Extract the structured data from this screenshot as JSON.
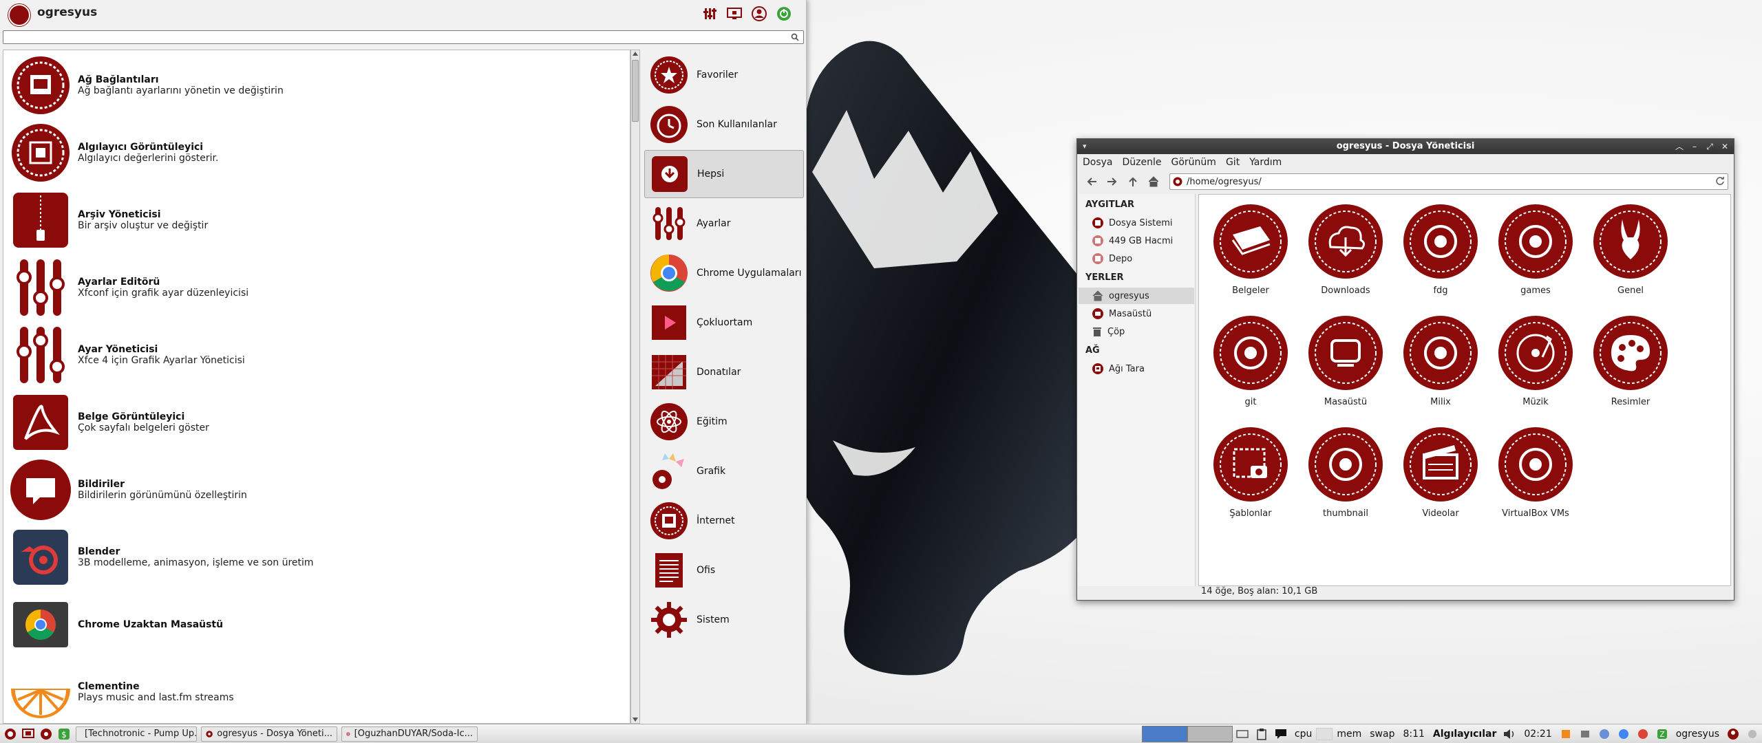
{
  "colors": {
    "accent": "#8b0a0a",
    "workspace_active": "#4a7cc9",
    "selection": "#dcdcdc"
  },
  "menu": {
    "username": "ogresyus",
    "actions": [
      "settings-icon",
      "lock-screen-icon",
      "switch-user-icon",
      "logout-icon"
    ],
    "search": {
      "placeholder": "",
      "value": ""
    },
    "apps": [
      {
        "name": "Ağ Bağlantıları",
        "desc": "Ağ bağlantı ayarlarını yönetin ve değiştirin",
        "icon": "network-icon"
      },
      {
        "name": "Algılayıcı Görüntüleyici",
        "desc": "Algılayıcı değerlerini gösterir.",
        "icon": "sensor-icon"
      },
      {
        "name": "Arşiv Yöneticisi",
        "desc": "Bir arşiv oluştur ve değiştir",
        "icon": "archive-icon"
      },
      {
        "name": "Ayarlar Editörü",
        "desc": "Xfconf için grafik ayar düzenleyicisi",
        "icon": "sliders-icon"
      },
      {
        "name": "Ayar Yöneticisi",
        "desc": "Xfce 4 için Grafik Ayarlar Yöneticisi",
        "icon": "sliders-icon"
      },
      {
        "name": "Belge Görüntüleyici",
        "desc": "Çok sayfalı belgeleri göster",
        "icon": "pdf-icon"
      },
      {
        "name": "Bildiriler",
        "desc": "Bildirilerin görünümünü özelleştirin",
        "icon": "notification-icon"
      },
      {
        "name": "Blender",
        "desc": "3B modelleme, animasyon, işleme ve son üretim",
        "icon": "blender-icon"
      },
      {
        "name": "Chrome Uzaktan Masaüstü",
        "desc": "",
        "icon": "chrome-icon"
      },
      {
        "name": "Clementine",
        "desc": "Plays music and last.fm streams",
        "icon": "clementine-icon"
      }
    ],
    "categories": [
      {
        "label": "Favoriler",
        "icon": "favorites-icon"
      },
      {
        "label": "Son Kullanılanlar",
        "icon": "recent-icon"
      },
      {
        "label": "Hepsi",
        "icon": "all-apps-icon",
        "selected": true
      },
      {
        "label": "Ayarlar",
        "icon": "settings-category-icon"
      },
      {
        "label": "Chrome Uygulamaları",
        "icon": "chrome-apps-icon"
      },
      {
        "label": "Çokluortam",
        "icon": "multimedia-icon"
      },
      {
        "label": "Donatılar",
        "icon": "accessories-icon"
      },
      {
        "label": "Eğitim",
        "icon": "education-icon"
      },
      {
        "label": "Grafik",
        "icon": "graphics-icon"
      },
      {
        "label": "İnternet",
        "icon": "internet-icon"
      },
      {
        "label": "Ofis",
        "icon": "office-icon"
      },
      {
        "label": "Sistem",
        "icon": "system-icon"
      }
    ]
  },
  "file_manager": {
    "title": "ogresyus - Dosya Yöneticisi",
    "menus": [
      "Dosya",
      "Düzenle",
      "Görünüm",
      "Git",
      "Yardım"
    ],
    "path": "/home/ogresyus/",
    "sidebar": {
      "devices_heading": "AYGITLAR",
      "devices": [
        "Dosya Sistemi",
        "449 GB Hacmi",
        "Depo"
      ],
      "places_heading": "YERLER",
      "places": [
        "ogresyus",
        "Masaüstü",
        "Çöp"
      ],
      "network_heading": "AĞ",
      "network": [
        "Ağı Tara"
      ]
    },
    "items": [
      {
        "label": "Belgeler",
        "icon": "documents-folder-icon"
      },
      {
        "label": "Downloads",
        "icon": "downloads-folder-icon"
      },
      {
        "label": "fdg",
        "icon": "folder-icon"
      },
      {
        "label": "games",
        "icon": "folder-icon"
      },
      {
        "label": "Genel",
        "icon": "public-folder-icon"
      },
      {
        "label": "git",
        "icon": "folder-icon"
      },
      {
        "label": "Masaüstü",
        "icon": "desktop-folder-icon"
      },
      {
        "label": "Milix",
        "icon": "folder-icon"
      },
      {
        "label": "Müzik",
        "icon": "music-folder-icon"
      },
      {
        "label": "Resimler",
        "icon": "pictures-folder-icon"
      },
      {
        "label": "Şablonlar",
        "icon": "templates-folder-icon"
      },
      {
        "label": "thumbnail",
        "icon": "folder-icon"
      },
      {
        "label": "Videolar",
        "icon": "videos-folder-icon"
      },
      {
        "label": "VirtualBox VMs",
        "icon": "folder-icon"
      }
    ],
    "status": "14 öğe, Boş alan: 10,1 GB"
  },
  "taskbar": {
    "tasks": [
      "[Technotronic - Pump Up...",
      "ogresyus - Dosya Yöneti...",
      "[OguzhanDUYAR/Soda-Ic..."
    ],
    "labels": {
      "cpu": "cpu",
      "mem": "mem",
      "swap": "swap",
      "time_small": "8:11",
      "sensors": "Algılayıcılar",
      "clock": "02:21",
      "user": "ogresyus"
    }
  }
}
